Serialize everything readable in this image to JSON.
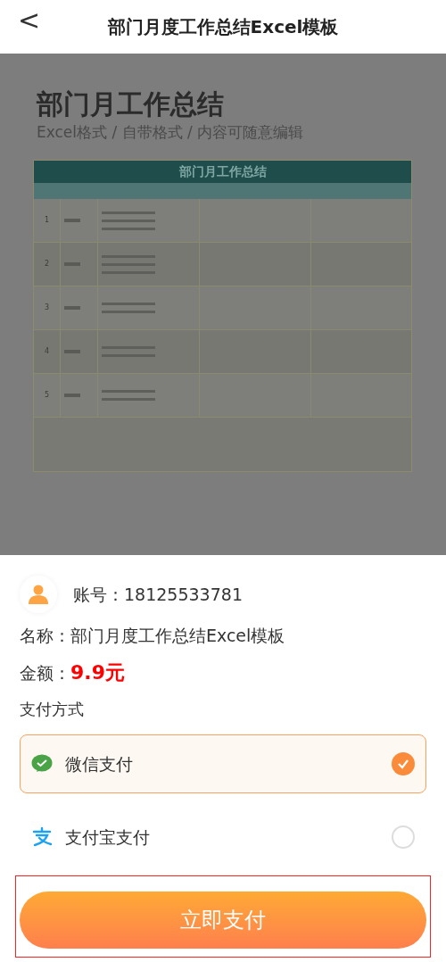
{
  "header": {
    "back_icon": "<",
    "title": "部门月度工作总结Excel模板"
  },
  "preview": {
    "title": "部门月工作总结",
    "subtitle": "Excel格式 / 自带格式 / 内容可随意编辑",
    "sheet_title": "部门月工作总结",
    "rows": [
      {
        "number": "1"
      },
      {
        "number": "2"
      },
      {
        "number": "3"
      },
      {
        "number": "4"
      },
      {
        "number": "5"
      }
    ]
  },
  "order": {
    "account": "账号：18125533781",
    "name_label": "名称：",
    "name": "部门月度工作总结Excel模板",
    "amount_label": "金额：",
    "amount": "9.9元",
    "payment_heading": "支付方式"
  },
  "payment_methods": [
    {
      "kind": "wechat",
      "label": "微信支付",
      "selected": true
    },
    {
      "kind": "alipay",
      "label": "支付宝支付",
      "selected": false
    }
  ],
  "pay_button": {
    "label": "立即支付",
    "highlighted": true
  }
}
